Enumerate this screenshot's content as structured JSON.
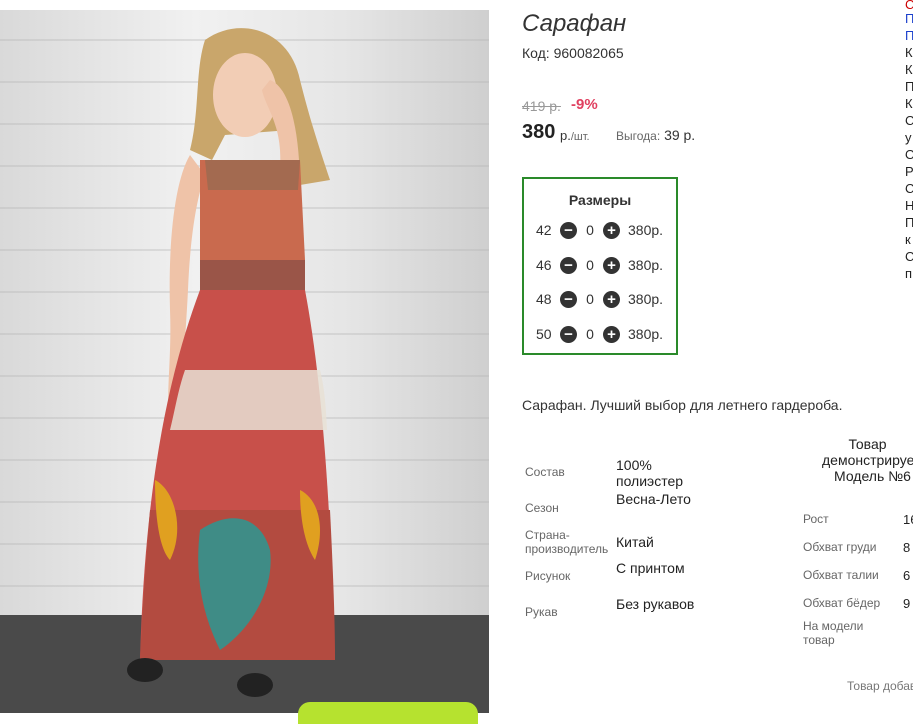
{
  "product": {
    "title": "Сарафан",
    "code_label": "Код:",
    "code_value": "960082065",
    "old_price": "419 р.",
    "discount": "-9%",
    "price": "380",
    "price_currency": "р.",
    "price_unit": "/шт.",
    "benefit_label": "Выгода:",
    "benefit_value": "39 р.",
    "description": "Сарафан. Лучший выбор для летнего гардероба."
  },
  "sizes": {
    "title": "Размеры",
    "rows": [
      {
        "size": "42",
        "qty": "0",
        "price": "380р."
      },
      {
        "size": "46",
        "qty": "0",
        "price": "380р."
      },
      {
        "size": "48",
        "qty": "0",
        "price": "380р."
      },
      {
        "size": "50",
        "qty": "0",
        "price": "380р."
      }
    ],
    "minus_icon": "minus-circle-icon",
    "plus_icon": "plus-circle-icon"
  },
  "attributes": [
    {
      "key": "Состав",
      "value": "100% полиэстер"
    },
    {
      "key": "Сезон",
      "value": "Весна-Лето"
    },
    {
      "key": "Страна-производитель",
      "value": "Китай"
    },
    {
      "key": "Рисунок",
      "value": "С принтом"
    },
    {
      "key": "Рукав",
      "value": "Без рукавов"
    }
  ],
  "model": {
    "line1": "Товар",
    "line2": "демонстрируе",
    "line3": "Модель №6",
    "measures": [
      {
        "key": "Рост",
        "value": "16"
      },
      {
        "key": "Обхват груди",
        "value": "8"
      },
      {
        "key": "Обхват талии",
        "value": "6"
      },
      {
        "key": "Обхват бёдер",
        "value": "9"
      },
      {
        "key": "На модели товар",
        "value": ""
      }
    ],
    "bottom_note": "Товар добав"
  },
  "right_column": [
    {
      "text": "С",
      "color": "#cc0000"
    },
    {
      "text": "П",
      "color": "#1a3fcc"
    },
    {
      "text": "П",
      "color": "#1a3fcc"
    },
    {
      "text": "К",
      "color": "#222222"
    },
    {
      "text": "К",
      "color": "#222222"
    },
    {
      "text": "П",
      "color": "#222222"
    },
    {
      "text": "К",
      "color": "#222222"
    },
    {
      "text": "С",
      "color": "#222222"
    },
    {
      "text": "у",
      "color": "#222222"
    },
    {
      "text": "О",
      "color": "#222222"
    },
    {
      "text": "Р",
      "color": "#222222"
    },
    {
      "text": "С",
      "color": "#222222"
    },
    {
      "text": "Н",
      "color": "#222222"
    },
    {
      "text": "П",
      "color": "#222222"
    },
    {
      "text": "к",
      "color": "#222222"
    },
    {
      "text": "С",
      "color": "#222222"
    },
    {
      "text": "п",
      "color": "#222222"
    }
  ],
  "colors": {
    "accent_green": "#2a8a2a",
    "discount_red": "#e04060",
    "button_lime": "#b6e22f"
  }
}
